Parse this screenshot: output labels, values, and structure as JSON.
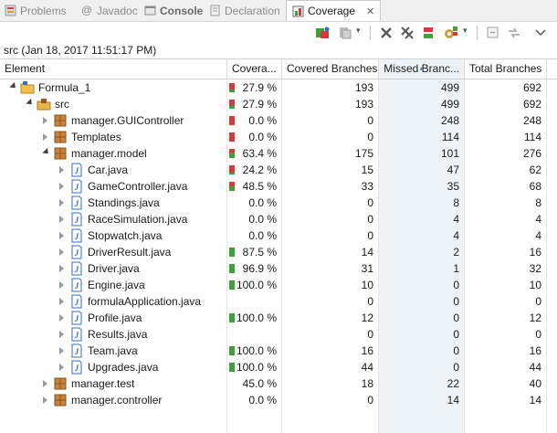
{
  "tabs": [
    {
      "label": "Problems",
      "icon": "problems-icon",
      "active": false
    },
    {
      "label": "Javadoc",
      "icon": "javadoc-at-icon",
      "active": false
    },
    {
      "label": "Console",
      "icon": "console-icon",
      "active": false
    },
    {
      "label": "Declaration",
      "icon": "declaration-icon",
      "active": false
    },
    {
      "label": "Coverage",
      "icon": "coverage-icon",
      "active": true,
      "close": "✕"
    }
  ],
  "toolbar_icons": [
    "relaunch-coverage-icon",
    "dump-execution-data-icon",
    "remove-session-icon",
    "remove-all-sessions-icon",
    "merge-sessions-icon",
    "select-session-icon",
    "collapse-all-icon",
    "link-with-editor-icon",
    "view-menu-icon"
  ],
  "session_label": "src (Jan 18, 2017 11:51:17 PM)",
  "columns": [
    "Element",
    "Covera...",
    "Covered Branches",
    "Missed Branc...",
    "Total Branches"
  ],
  "colors": {
    "covered": "#3ca23c",
    "missed": "#d83a3a",
    "project": "#f0c050",
    "folder": "#e8b54a",
    "package": "#c8833a",
    "java": "#3a6fb8"
  },
  "rows": [
    {
      "level": 0,
      "twisty": "expanded",
      "icon": "project-folder-icon",
      "name": "Formula_1",
      "coverage": "27.9 %",
      "covered": "193",
      "missed": "499",
      "total": "692",
      "ratio": 0.279,
      "hasBar": true
    },
    {
      "level": 1,
      "twisty": "expanded",
      "icon": "source-folder-icon",
      "name": "src",
      "coverage": "27.9 %",
      "covered": "193",
      "missed": "499",
      "total": "692",
      "ratio": 0.279,
      "hasBar": true
    },
    {
      "level": 2,
      "twisty": "collapsed",
      "icon": "package-icon",
      "name": "manager.GUIController",
      "coverage": "0.0 %",
      "covered": "0",
      "missed": "248",
      "total": "248",
      "ratio": 0.0,
      "hasBar": true
    },
    {
      "level": 2,
      "twisty": "collapsed",
      "icon": "package-icon",
      "name": "Templates",
      "coverage": "0.0 %",
      "covered": "0",
      "missed": "114",
      "total": "114",
      "ratio": 0.0,
      "hasBar": true
    },
    {
      "level": 2,
      "twisty": "expanded",
      "icon": "package-icon",
      "name": "manager.model",
      "coverage": "63.4 %",
      "covered": "175",
      "missed": "101",
      "total": "276",
      "ratio": 0.634,
      "hasBar": true
    },
    {
      "level": 3,
      "twisty": "collapsed",
      "icon": "java-file-icon",
      "name": "Car.java",
      "coverage": "24.2 %",
      "covered": "15",
      "missed": "47",
      "total": "62",
      "ratio": 0.242,
      "hasBar": true
    },
    {
      "level": 3,
      "twisty": "collapsed",
      "icon": "java-file-icon",
      "name": "GameController.java",
      "coverage": "48.5 %",
      "covered": "33",
      "missed": "35",
      "total": "68",
      "ratio": 0.485,
      "hasBar": true
    },
    {
      "level": 3,
      "twisty": "collapsed",
      "icon": "java-file-icon",
      "name": "Standings.java",
      "coverage": "0.0 %",
      "covered": "0",
      "missed": "8",
      "total": "8",
      "ratio": 0.0,
      "hasBar": false
    },
    {
      "level": 3,
      "twisty": "collapsed",
      "icon": "java-file-icon",
      "name": "RaceSimulation.java",
      "coverage": "0.0 %",
      "covered": "0",
      "missed": "4",
      "total": "4",
      "ratio": 0.0,
      "hasBar": false
    },
    {
      "level": 3,
      "twisty": "collapsed",
      "icon": "java-file-icon",
      "name": "Stopwatch.java",
      "coverage": "0.0 %",
      "covered": "0",
      "missed": "4",
      "total": "4",
      "ratio": 0.0,
      "hasBar": false
    },
    {
      "level": 3,
      "twisty": "collapsed",
      "icon": "java-file-icon",
      "name": "DriverResult.java",
      "coverage": "87.5 %",
      "covered": "14",
      "missed": "2",
      "total": "16",
      "ratio": 0.875,
      "hasBar": true
    },
    {
      "level": 3,
      "twisty": "collapsed",
      "icon": "java-file-icon",
      "name": "Driver.java",
      "coverage": "96.9 %",
      "covered": "31",
      "missed": "1",
      "total": "32",
      "ratio": 0.969,
      "hasBar": true
    },
    {
      "level": 3,
      "twisty": "collapsed",
      "icon": "java-file-icon",
      "name": "Engine.java",
      "coverage": "100.0 %",
      "covered": "10",
      "missed": "0",
      "total": "10",
      "ratio": 1.0,
      "hasBar": true
    },
    {
      "level": 3,
      "twisty": "collapsed",
      "icon": "java-file-icon",
      "name": "formulaApplication.java",
      "coverage": "",
      "covered": "0",
      "missed": "0",
      "total": "0",
      "ratio": 0,
      "hasBar": false
    },
    {
      "level": 3,
      "twisty": "collapsed",
      "icon": "java-file-icon",
      "name": "Profile.java",
      "coverage": "100.0 %",
      "covered": "12",
      "missed": "0",
      "total": "12",
      "ratio": 1.0,
      "hasBar": true
    },
    {
      "level": 3,
      "twisty": "collapsed",
      "icon": "java-file-icon",
      "name": "Results.java",
      "coverage": "",
      "covered": "0",
      "missed": "0",
      "total": "0",
      "ratio": 0,
      "hasBar": false
    },
    {
      "level": 3,
      "twisty": "collapsed",
      "icon": "java-file-icon",
      "name": "Team.java",
      "coverage": "100.0 %",
      "covered": "16",
      "missed": "0",
      "total": "16",
      "ratio": 1.0,
      "hasBar": true
    },
    {
      "level": 3,
      "twisty": "collapsed",
      "icon": "java-file-icon",
      "name": "Upgrades.java",
      "coverage": "100.0 %",
      "covered": "44",
      "missed": "0",
      "total": "44",
      "ratio": 1.0,
      "hasBar": true
    },
    {
      "level": 2,
      "twisty": "collapsed",
      "icon": "package-icon",
      "name": "manager.test",
      "coverage": "45.0 %",
      "covered": "18",
      "missed": "22",
      "total": "40",
      "ratio": 0.45,
      "hasBar": false
    },
    {
      "level": 2,
      "twisty": "collapsed",
      "icon": "package-icon",
      "name": "manager.controller",
      "coverage": "0.0 %",
      "covered": "0",
      "missed": "14",
      "total": "14",
      "ratio": 0.0,
      "hasBar": false
    }
  ]
}
